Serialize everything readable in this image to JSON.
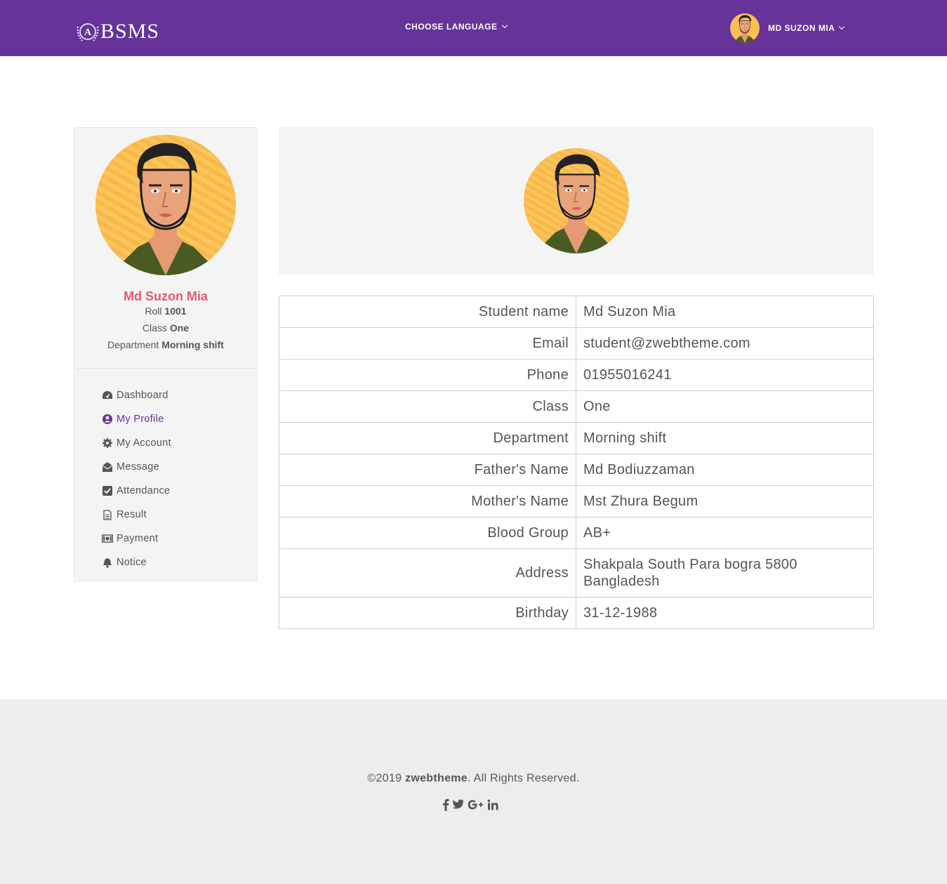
{
  "header": {
    "logo_text": "BSMS",
    "language_label": "CHOOSE LANGUAGE",
    "user_name": "MD SUZON MIA"
  },
  "sidebar": {
    "name": "Md Suzon Mia",
    "roll_label": "Roll",
    "roll_value": "1001",
    "class_label": "Class",
    "class_value": "One",
    "department_label": "Department",
    "department_value": "Morning shift",
    "nav": [
      {
        "label": "Dashboard",
        "icon": "dashboard-icon"
      },
      {
        "label": "My Profile",
        "icon": "user-circle-icon",
        "active": true
      },
      {
        "label": "My Account",
        "icon": "gear-icon"
      },
      {
        "label": "Message",
        "icon": "envelope-open-icon"
      },
      {
        "label": "Attendance",
        "icon": "check-square-icon"
      },
      {
        "label": "Result",
        "icon": "file-text-icon"
      },
      {
        "label": "Payment",
        "icon": "money-icon"
      },
      {
        "label": "Notice",
        "icon": "bell-icon"
      }
    ]
  },
  "profile": {
    "rows": [
      {
        "key": "Student name",
        "value": "Md Suzon Mia"
      },
      {
        "key": "Email",
        "value": "student@zwebtheme.com"
      },
      {
        "key": "Phone",
        "value": "01955016241"
      },
      {
        "key": "Class",
        "value": "One"
      },
      {
        "key": "Department",
        "value": "Morning shift"
      },
      {
        "key": "Father's Name",
        "value": "Md Bodiuzzaman"
      },
      {
        "key": "Mother's Name",
        "value": "Mst Zhura Begum"
      },
      {
        "key": "Blood Group",
        "value": "AB+"
      },
      {
        "key": "Address",
        "value": "Shakpala South Para bogra 5800 Bangladesh"
      },
      {
        "key": "Birthday",
        "value": "31-12-1988"
      }
    ]
  },
  "footer": {
    "copyright_prefix": "©2019 ",
    "brand": "zwebtheme",
    "copyright_suffix": ". All Rights Reserved.",
    "social": [
      "facebook-icon",
      "twitter-icon",
      "google-plus-icon",
      "linkedin-icon"
    ]
  },
  "colors": {
    "header_bg": "#663399",
    "accent_name": "#e85a6f",
    "active_nav": "#663399",
    "avatar_bg": "#fdc45a"
  }
}
